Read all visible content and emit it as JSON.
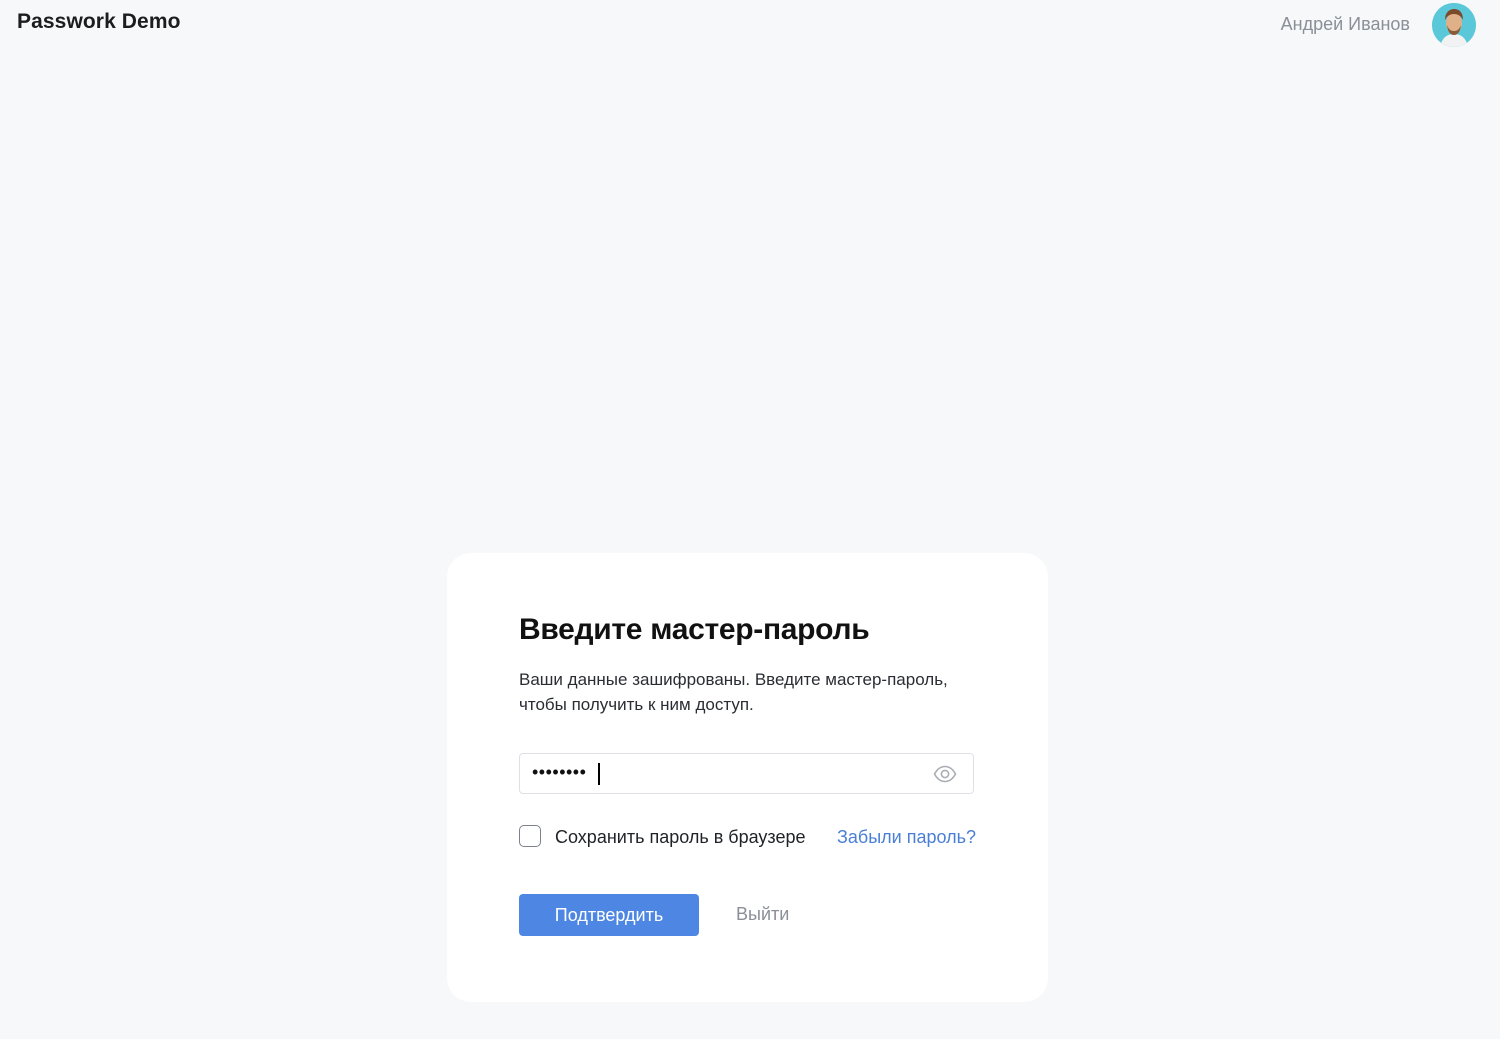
{
  "header": {
    "brand": "Passwork Demo",
    "user_name": "Андрей Иванов",
    "avatar_icon": "user-avatar-photo"
  },
  "dialog": {
    "title": "Введите мастер-пароль",
    "subtitle": "Ваши данные зашифрованы. Введите мастер-пароль, чтобы получить к ним доступ.",
    "password_value": "••••••••",
    "show_password_icon": "eye-icon",
    "remember_label": "Сохранить пароль в браузере",
    "remember_checked": false,
    "forgot_label": "Забыли пароль?",
    "confirm_label": "Подтвердить",
    "logout_label": "Выйти"
  },
  "colors": {
    "background": "#f6f8fa",
    "card": "#ffffff",
    "primary": "#4d87e3",
    "link": "#4a7fd6",
    "muted_text": "#8a8f98"
  }
}
